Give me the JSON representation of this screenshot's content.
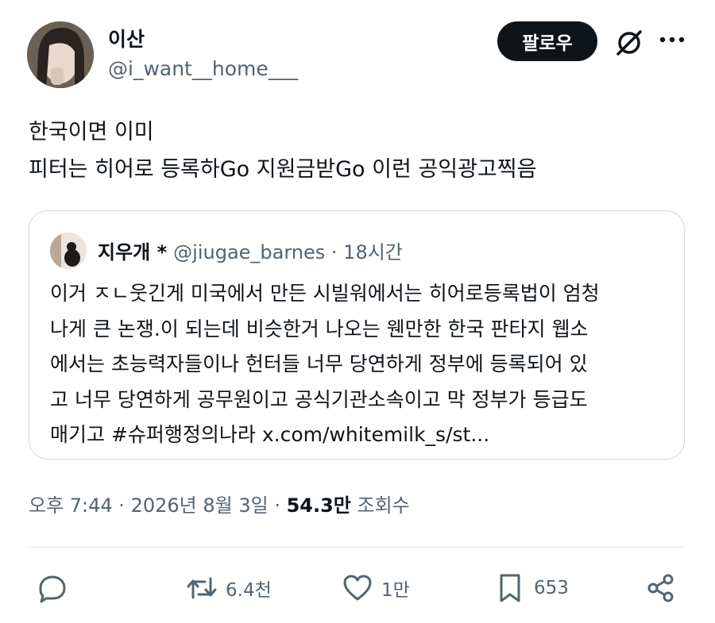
{
  "author": {
    "name": "이산",
    "handle": "@i_want__home___"
  },
  "follow_label": "팔로우",
  "tweet_lines": [
    "한국이면 이미",
    "피터는 히어로 등록하Go 지원금받Go 이런 공익광고찍음"
  ],
  "quote": {
    "name": "지우개 *",
    "handle": "@jiugae_barnes",
    "time": "· 18시간",
    "lines": [
      "이거 ㅈㄴ웃긴게 미국에서 만든 시빌워에서는 히어로등록법이 엄청",
      "나게 큰 논쟁.이 되는데 비슷한거 나오는 웬만한 한국 판타지 웹소",
      "에서는 초능력자들이나 헌터들 너무 당연하게 정부에 등록되어 있",
      "고 너무 당연하게 공무원이고 공식기관소속이고 막 정부가 등급도",
      "매기고 #슈퍼행정의나라 x.com/whitemilk_s/st..."
    ]
  },
  "meta": {
    "datetime": "오후 7:44 · 2026년 8월 3일 · ",
    "views_count": "54.3만",
    "views_label": " 조회수"
  },
  "actions": {
    "reply_icon": "reply-icon",
    "retweets": "6.4천",
    "likes": "1만",
    "bookmarks": "653"
  }
}
